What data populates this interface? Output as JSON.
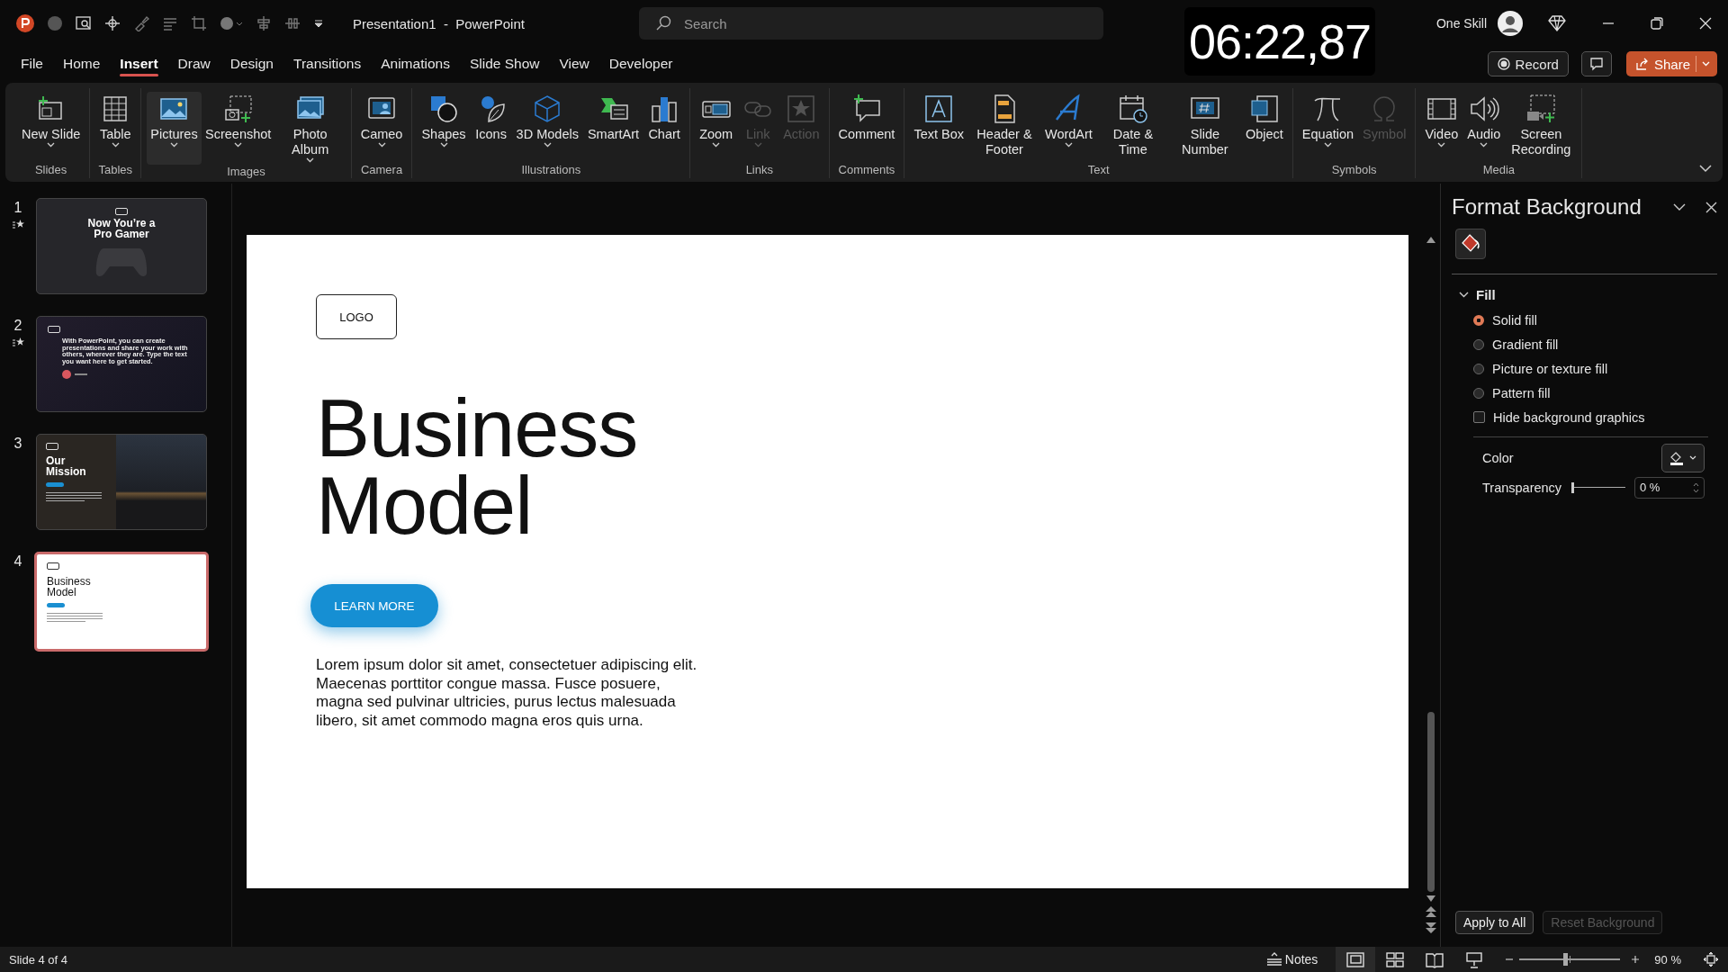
{
  "title_bar": {
    "document_title": "Presentation1  -  PowerPoint",
    "search": {
      "placeholder": "Search"
    },
    "timer": "06:22,87",
    "user": "One Skill"
  },
  "header_buttons": {
    "record": "Record",
    "share": "Share"
  },
  "tabs": [
    {
      "label": "File",
      "selected": false
    },
    {
      "label": "Home",
      "selected": false
    },
    {
      "label": "Insert",
      "selected": true
    },
    {
      "label": "Draw",
      "selected": false
    },
    {
      "label": "Design",
      "selected": false
    },
    {
      "label": "Transitions",
      "selected": false
    },
    {
      "label": "Animations",
      "selected": false
    },
    {
      "label": "Slide Show",
      "selected": false
    },
    {
      "label": "View",
      "selected": false
    },
    {
      "label": "Developer",
      "selected": false
    }
  ],
  "ribbon": {
    "groups": [
      {
        "label": "Slides",
        "buttons": [
          {
            "label": "New Slide",
            "dropdown": true,
            "disabled": false
          }
        ]
      },
      {
        "label": "Tables",
        "buttons": [
          {
            "label": "Table",
            "dropdown": true,
            "disabled": false
          }
        ]
      },
      {
        "label": "Images",
        "buttons": [
          {
            "label": "Pictures",
            "dropdown": true,
            "disabled": false
          },
          {
            "label": "Screenshot",
            "dropdown": true,
            "disabled": false
          },
          {
            "label": "Photo Album",
            "dropdown": true,
            "disabled": false
          }
        ]
      },
      {
        "label": "Camera",
        "buttons": [
          {
            "label": "Cameo",
            "dropdown": true,
            "disabled": false
          }
        ]
      },
      {
        "label": "Illustrations",
        "buttons": [
          {
            "label": "Shapes",
            "dropdown": true,
            "disabled": false
          },
          {
            "label": "Icons",
            "dropdown": false,
            "disabled": false
          },
          {
            "label": "3D Models",
            "dropdown": true,
            "disabled": false
          },
          {
            "label": "SmartArt",
            "dropdown": false,
            "disabled": false
          },
          {
            "label": "Chart",
            "dropdown": false,
            "disabled": false
          }
        ]
      },
      {
        "label": "Links",
        "buttons": [
          {
            "label": "Zoom",
            "dropdown": true,
            "disabled": false
          },
          {
            "label": "Link",
            "dropdown": true,
            "disabled": true
          },
          {
            "label": "Action",
            "dropdown": false,
            "disabled": true
          }
        ]
      },
      {
        "label": "Comments",
        "buttons": [
          {
            "label": "Comment",
            "dropdown": false,
            "disabled": false
          }
        ]
      },
      {
        "label": "Text",
        "buttons": [
          {
            "label": "Text Box",
            "dropdown": false,
            "disabled": false
          },
          {
            "label": "Header & Footer",
            "dropdown": false,
            "disabled": false
          },
          {
            "label": "WordArt",
            "dropdown": true,
            "disabled": false
          },
          {
            "label": "Date & Time",
            "dropdown": false,
            "disabled": false
          },
          {
            "label": "Slide Number",
            "dropdown": false,
            "disabled": false
          },
          {
            "label": "Object",
            "dropdown": false,
            "disabled": false
          }
        ]
      },
      {
        "label": "Symbols",
        "buttons": [
          {
            "label": "Equation",
            "dropdown": true,
            "disabled": false
          },
          {
            "label": "Symbol",
            "dropdown": false,
            "disabled": true
          }
        ]
      },
      {
        "label": "Media",
        "buttons": [
          {
            "label": "Video",
            "dropdown": true,
            "disabled": false
          },
          {
            "label": "Audio",
            "dropdown": true,
            "disabled": false
          },
          {
            "label": "Screen Recording",
            "dropdown": false,
            "disabled": false
          }
        ]
      }
    ]
  },
  "slides": [
    {
      "number": "1",
      "kind": "gamer",
      "animated": true,
      "selected": false,
      "title": "Now You’re a Pro Gamer"
    },
    {
      "number": "2",
      "kind": "quote",
      "animated": true,
      "selected": false,
      "title": "With PowerPoint, you can create presentations and share your work with others, wherever they are. Type the text you want here to get started."
    },
    {
      "number": "3",
      "kind": "mission",
      "animated": false,
      "selected": false,
      "title": "Our Mission"
    },
    {
      "number": "4",
      "kind": "business",
      "animated": false,
      "selected": true,
      "title": "Business Model"
    }
  ],
  "slide": {
    "logo": "LOGO",
    "title": "Business Model",
    "button": "LEARN MORE",
    "body": "Lorem ipsum dolor sit amet, consectetuer adipiscing elit. Maecenas porttitor congue massa. Fusce posuere, magna sed pulvinar ultricies, purus lectus malesuada libero, sit amet commodo magna eros quis urna."
  },
  "format_panel": {
    "title": "Format Background",
    "section": {
      "label": "Fill",
      "expanded": true
    },
    "options": [
      {
        "label": "Solid fill",
        "selected": true
      },
      {
        "label": "Gradient fill",
        "selected": false
      },
      {
        "label": "Picture or texture fill",
        "selected": false
      },
      {
        "label": "Pattern fill",
        "selected": false
      }
    ],
    "hide_graphics": {
      "label": "Hide background graphics",
      "checked": false
    },
    "color_label": "Color",
    "transparency": {
      "label": "Transparency",
      "level": 0,
      "reading": "0 %"
    },
    "buttons": [
      {
        "label": "Apply to All",
        "disabled": false
      },
      {
        "label": "Reset Background",
        "disabled": true
      }
    ]
  },
  "status_bar": {
    "slide_info": "Slide 4 of 4",
    "notes": "Notes",
    "views": [
      {
        "selected": true
      },
      {
        "selected": false
      },
      {
        "selected": false
      },
      {
        "selected": false
      }
    ],
    "zoom": {
      "level": 0.45,
      "reading": "90 %"
    }
  }
}
